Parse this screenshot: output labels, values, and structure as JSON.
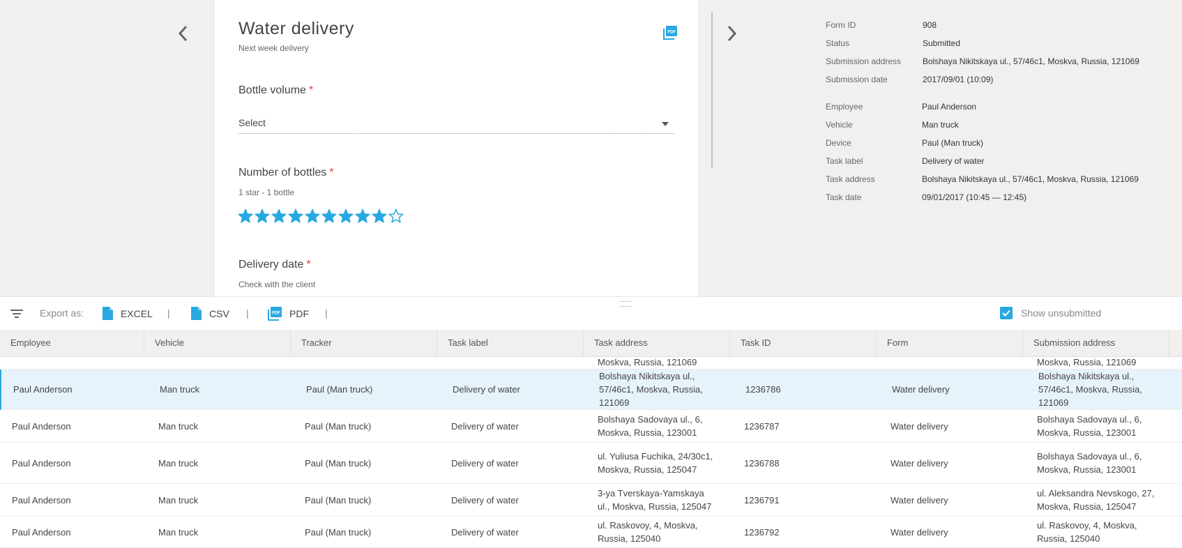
{
  "form": {
    "title": "Water delivery",
    "subtitle": "Next week delivery",
    "questions": [
      {
        "label": "Bottle volume",
        "required_mark": "*",
        "type": "select",
        "value": "Select"
      },
      {
        "label": "Number of bottles",
        "required_mark": "*",
        "hint": "1 star - 1 bottle",
        "type": "rating",
        "rating": 9,
        "max": 10
      },
      {
        "label": "Delivery date",
        "required_mark": "*",
        "hint": "Check with the client"
      }
    ],
    "pdf_icon": "pdf-file-icon"
  },
  "meta": {
    "form_id": {
      "key": "Form ID",
      "value": "908"
    },
    "status": {
      "key": "Status",
      "value": "Submitted"
    },
    "submission_address": {
      "key": "Submission address",
      "value": "Bolshaya Nikitskaya ul., 57/46c1, Moskva, Russia, 121069"
    },
    "submission_date": {
      "key": "Submission date",
      "value": "2017/09/01 (10:09)"
    },
    "employee": {
      "key": "Employee",
      "value": "Paul Anderson"
    },
    "vehicle": {
      "key": "Vehicle",
      "value": "Man truck"
    },
    "device": {
      "key": "Device",
      "value": "Paul (Man truck)"
    },
    "task_label": {
      "key": "Task label",
      "value": "Delivery of water"
    },
    "task_address": {
      "key": "Task address",
      "value": "Bolshaya Nikitskaya ul., 57/46c1, Moskva, Russia, 121069"
    },
    "task_date": {
      "key": "Task date",
      "value": "09/01/2017 (10:45 — 12:45)"
    }
  },
  "toolbar": {
    "export_label": "Export as:",
    "excel": "EXCEL",
    "csv": "CSV",
    "pdf": "PDF",
    "separator": "|",
    "show_unsubmitted": "Show unsubmitted",
    "show_unsubmitted_checked": true
  },
  "table": {
    "columns": [
      "Employee",
      "Vehicle",
      "Tracker",
      "Task label",
      "Task address",
      "Task ID",
      "Form",
      "Submission address"
    ],
    "partial_row": {
      "task_address": "Moskva, Russia, 121069",
      "submission_address": "Moskva, Russia, 121069"
    },
    "rows": [
      {
        "employee": "Paul Anderson",
        "vehicle": "Man truck",
        "tracker": "Paul (Man truck)",
        "task_label": "Delivery of water",
        "task_address": "Bolshaya Nikitskaya ul., 57/46c1, Moskva, Russia, 121069",
        "task_id": "1236786",
        "form": "Water delivery",
        "submission_address": "Bolshaya Nikitskaya ul., 57/46c1, Moskva, Russia, 121069"
      },
      {
        "employee": "Paul Anderson",
        "vehicle": "Man truck",
        "tracker": "Paul (Man truck)",
        "task_label": "Delivery of water",
        "task_address": "Bolshaya Sadovaya ul., 6, Moskva, Russia, 123001",
        "task_id": "1236787",
        "form": "Water delivery",
        "submission_address": "Bolshaya Sadovaya ul., 6, Moskva, Russia, 123001"
      },
      {
        "employee": "Paul Anderson",
        "vehicle": "Man truck",
        "tracker": "Paul (Man truck)",
        "task_label": "Delivery of water",
        "task_address": "ul. Yuliusa Fuchika, 24/30c1, Moskva, Russia, 125047",
        "task_id": "1236788",
        "form": "Water delivery",
        "submission_address": "Bolshaya Sadovaya ul., 6, Moskva, Russia, 123001"
      },
      {
        "employee": "Paul Anderson",
        "vehicle": "Man truck",
        "tracker": "Paul (Man truck)",
        "task_label": "Delivery of water",
        "task_address": "3-ya Tverskaya-Yamskaya ul., Moskva, Russia, 125047",
        "task_id": "1236791",
        "form": "Water delivery",
        "submission_address": "ul. Aleksandra Nevskogo, 27, Moskva, Russia, 125047"
      },
      {
        "employee": "Paul Anderson",
        "vehicle": "Man truck",
        "tracker": "Paul (Man truck)",
        "task_label": "Delivery of water",
        "task_address": "ul. Raskovoy, 4, Moskva, Russia, 125040",
        "task_id": "1236792",
        "form": "Water delivery",
        "submission_address": "ul. Raskovoy, 4, Moskva, Russia, 125040"
      }
    ]
  },
  "colors": {
    "accent": "#29a8e0",
    "required": "#e53935",
    "selected_row": "#e6f3fa"
  }
}
